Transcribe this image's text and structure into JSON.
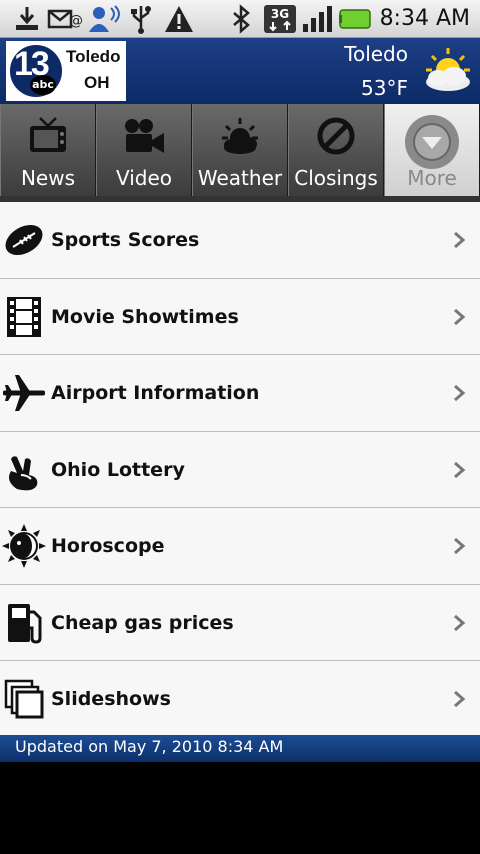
{
  "status_bar": {
    "time": "8:34 AM",
    "icons": [
      "download-icon",
      "email-icon",
      "account-sync-icon",
      "usb-icon",
      "warning-icon",
      "bluetooth-icon",
      "3g-data-icon",
      "signal-icon",
      "battery-icon"
    ],
    "network_label": "3G"
  },
  "header": {
    "logo_number": "13",
    "logo_network": "abc",
    "logo_city": "Toledo",
    "logo_state": "OH",
    "city": "Toledo",
    "temperature": "53°F",
    "weather_icon": "partly-cloudy-icon"
  },
  "tabs": [
    {
      "label": "News",
      "icon": "tv-icon",
      "active": false
    },
    {
      "label": "Video",
      "icon": "video-camera-icon",
      "active": false
    },
    {
      "label": "Weather",
      "icon": "sun-cloud-icon",
      "active": false
    },
    {
      "label": "Closings",
      "icon": "no-entry-icon",
      "active": false
    },
    {
      "label": "More",
      "icon": "more-chevron-icon",
      "active": true
    }
  ],
  "list": [
    {
      "label": "Sports Scores",
      "icon": "football-icon"
    },
    {
      "label": "Movie Showtimes",
      "icon": "film-strip-icon"
    },
    {
      "label": "Airport Information",
      "icon": "airplane-icon"
    },
    {
      "label": "Ohio Lottery",
      "icon": "crossed-fingers-icon"
    },
    {
      "label": "Horoscope",
      "icon": "sun-moon-icon"
    },
    {
      "label": "Cheap gas prices",
      "icon": "gas-pump-icon"
    },
    {
      "label": "Slideshows",
      "icon": "slideshow-icon"
    }
  ],
  "footer": {
    "updated_text": "Updated on May 7, 2010 8:34 AM"
  },
  "colors": {
    "header_blue": "#1e3f86",
    "footer_blue": "#1d4d94",
    "battery_green": "#6fcf2e"
  }
}
